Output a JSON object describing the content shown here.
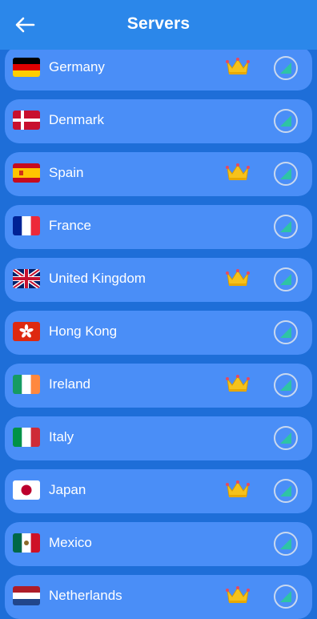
{
  "header": {
    "title": "Servers",
    "back_icon": "arrow-left-icon"
  },
  "colors": {
    "app_bar": "#2b87ea",
    "background": "#1e6ed8",
    "card": "#4a8ef7",
    "text": "#ffffff",
    "premium_crown": "#f6c21b",
    "signal": "#2ec4a5"
  },
  "servers": [
    {
      "name": "Germany",
      "premium": true,
      "flag_icon": "germany-flag-icon"
    },
    {
      "name": "Denmark",
      "premium": false,
      "flag_icon": "denmark-flag-icon"
    },
    {
      "name": "Spain",
      "premium": true,
      "flag_icon": "spain-flag-icon"
    },
    {
      "name": "France",
      "premium": false,
      "flag_icon": "france-flag-icon"
    },
    {
      "name": "United Kingdom",
      "premium": true,
      "flag_icon": "united-kingdom-flag-icon"
    },
    {
      "name": "Hong Kong",
      "premium": false,
      "flag_icon": "hong-kong-flag-icon"
    },
    {
      "name": "Ireland",
      "premium": true,
      "flag_icon": "ireland-flag-icon"
    },
    {
      "name": "Italy",
      "premium": false,
      "flag_icon": "italy-flag-icon"
    },
    {
      "name": "Japan",
      "premium": true,
      "flag_icon": "japan-flag-icon"
    },
    {
      "name": "Mexico",
      "premium": false,
      "flag_icon": "mexico-flag-icon"
    },
    {
      "name": "Netherlands",
      "premium": true,
      "flag_icon": "netherlands-flag-icon"
    }
  ]
}
